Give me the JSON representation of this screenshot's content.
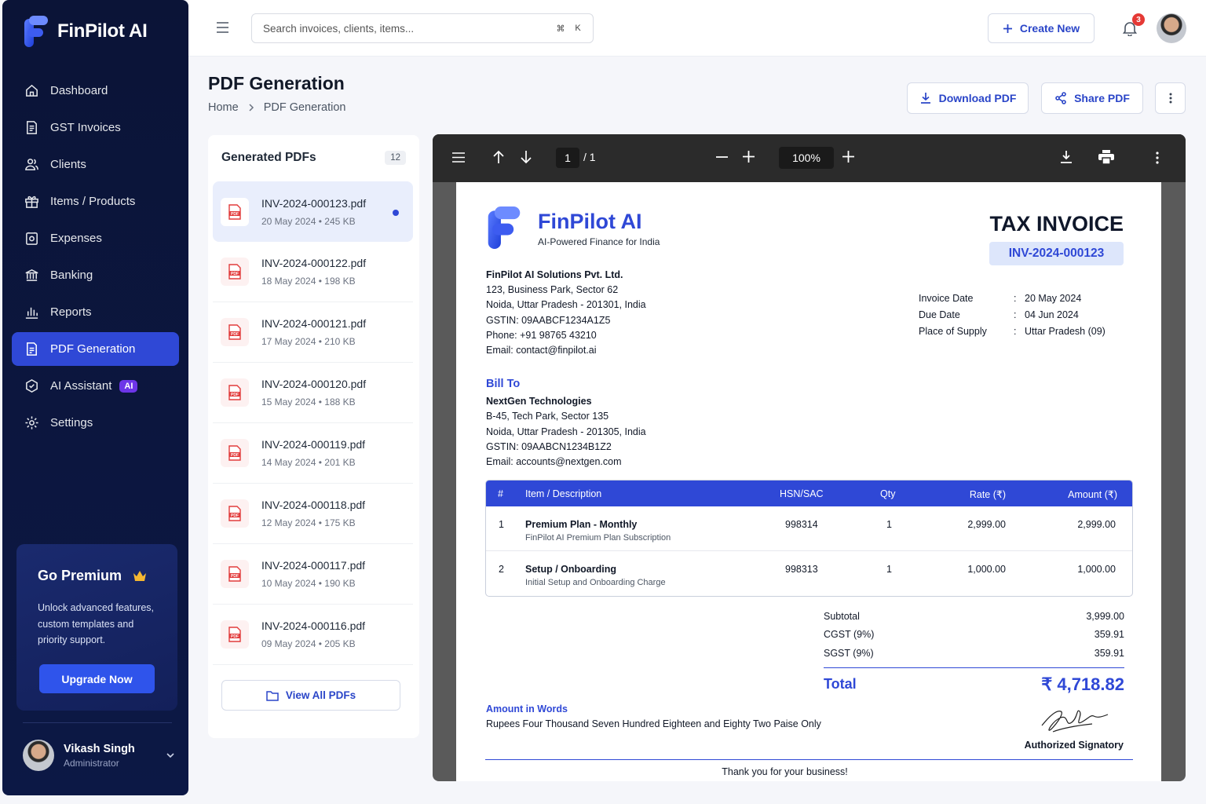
{
  "brand": {
    "name": "FinPilot AI"
  },
  "sidebar": {
    "items": [
      {
        "label": "Dashboard",
        "icon": "home-icon"
      },
      {
        "label": "GST Invoices",
        "icon": "invoice-icon"
      },
      {
        "label": "Clients",
        "icon": "users-icon"
      },
      {
        "label": "Items / Products",
        "icon": "gift-box-icon"
      },
      {
        "label": "Expenses",
        "icon": "wallet-icon"
      },
      {
        "label": "Banking",
        "icon": "bank-icon"
      },
      {
        "label": "Reports",
        "icon": "bar-chart-icon"
      },
      {
        "label": "PDF Generation",
        "icon": "pdf-file-icon",
        "active": true
      },
      {
        "label": "AI Assistant",
        "icon": "ai-sparkle-icon",
        "badge": "AI"
      },
      {
        "label": "Settings",
        "icon": "gear-icon"
      }
    ],
    "premium": {
      "title": "Go Premium",
      "text": "Unlock advanced features, custom templates and priority support.",
      "button": "Upgrade Now"
    },
    "user": {
      "name": "Vikash Singh",
      "role": "Administrator"
    }
  },
  "header": {
    "search_placeholder": "Search invoices, clients, items...",
    "shortcut": [
      "⌘",
      "K"
    ],
    "create_label": "Create New",
    "notifications": "3"
  },
  "page": {
    "title": "PDF Generation",
    "breadcrumb": [
      "Home",
      "PDF Generation"
    ],
    "download_label": "Download PDF",
    "share_label": "Share PDF"
  },
  "pdf_list": {
    "title": "Generated PDFs",
    "count": "12",
    "items": [
      {
        "name": "INV-2024-000123.pdf",
        "date": "20 May 2024",
        "size": "245 KB"
      },
      {
        "name": "INV-2024-000122.pdf",
        "date": "18 May 2024",
        "size": "198 KB"
      },
      {
        "name": "INV-2024-000121.pdf",
        "date": "17 May 2024",
        "size": "210 KB"
      },
      {
        "name": "INV-2024-000120.pdf",
        "date": "15 May 2024",
        "size": "188 KB"
      },
      {
        "name": "INV-2024-000119.pdf",
        "date": "14 May 2024",
        "size": "201 KB"
      },
      {
        "name": "INV-2024-000118.pdf",
        "date": "12 May 2024",
        "size": "175 KB"
      },
      {
        "name": "INV-2024-000117.pdf",
        "date": "10 May 2024",
        "size": "190 KB"
      },
      {
        "name": "INV-2024-000116.pdf",
        "date": "09 May 2024",
        "size": "205 KB"
      }
    ],
    "view_all": "View All PDFs"
  },
  "viewer": {
    "page": "1",
    "page_total": "/ 1",
    "zoom": "100%"
  },
  "invoice": {
    "company": "FinPilot AI",
    "tagline": "AI-Powered Finance for India",
    "doc_title": "TAX INVOICE",
    "number": "INV-2024-000123",
    "from": {
      "name": "FinPilot AI Solutions Pvt. Ltd.",
      "lines": [
        "123, Business Park, Sector 62",
        "Noida, Uttar Pradesh - 201301, India",
        "GSTIN: 09AABCF1234A1Z5",
        "Phone: +91 98765 43210",
        "Email: contact@finpilot.ai"
      ]
    },
    "meta": [
      {
        "k": "Invoice Date",
        "v": "20 May 2024"
      },
      {
        "k": "Due Date",
        "v": "04 Jun 2024"
      },
      {
        "k": "Place of Supply",
        "v": "Uttar Pradesh (09)"
      }
    ],
    "bill_to": {
      "heading": "Bill To",
      "name": "NextGen Technologies",
      "lines": [
        "B-45, Tech Park, Sector 135",
        "Noida, Uttar Pradesh - 201305, India",
        "GSTIN: 09AABCN1234B1Z2",
        "Email: accounts@nextgen.com"
      ]
    },
    "columns": [
      "#",
      "Item / Description",
      "HSN/SAC",
      "Qty",
      "Rate (₹)",
      "Amount (₹)"
    ],
    "rows": [
      {
        "no": "1",
        "item": "Premium Plan - Monthly",
        "desc": "FinPilot AI Premium Plan Subscription",
        "hsn": "998314",
        "qty": "1",
        "rate": "2,999.00",
        "amount": "2,999.00"
      },
      {
        "no": "2",
        "item": "Setup / Onboarding",
        "desc": "Initial Setup and Onboarding Charge",
        "hsn": "998313",
        "qty": "1",
        "rate": "1,000.00",
        "amount": "1,000.00"
      }
    ],
    "totals": [
      {
        "k": "Subtotal",
        "v": "3,999.00"
      },
      {
        "k": "CGST (9%)",
        "v": "359.91"
      },
      {
        "k": "SGST (9%)",
        "v": "359.91"
      }
    ],
    "total_label": "Total",
    "total_value": "₹ 4,718.82",
    "words_heading": "Amount in Words",
    "words": "Rupees Four Thousand Seven Hundred Eighteen and Eighty Two Paise Only",
    "signatory": "Authorized Signatory",
    "thanks": "Thank you for your business!"
  },
  "colors": {
    "accent": "#2f48d6",
    "sidebar": "#0b1437",
    "badge": "#e53935",
    "ai_badge": "#6d35e8"
  }
}
